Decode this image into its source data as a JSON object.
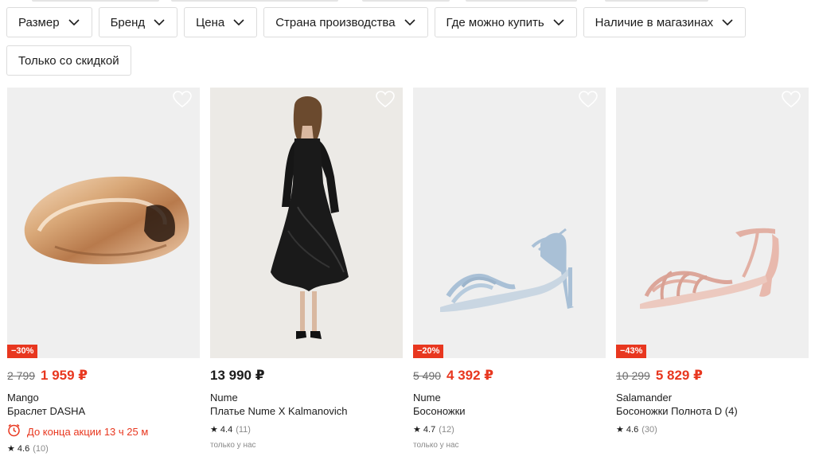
{
  "filters": [
    {
      "label": "Размер",
      "has_dropdown": true
    },
    {
      "label": "Бренд",
      "has_dropdown": true
    },
    {
      "label": "Цена",
      "has_dropdown": true
    },
    {
      "label": "Страна производства",
      "has_dropdown": true
    },
    {
      "label": "Где можно купить",
      "has_dropdown": true
    },
    {
      "label": "Наличие в магазинах",
      "has_dropdown": true
    },
    {
      "label": "Только со скидкой",
      "has_dropdown": false
    }
  ],
  "products": [
    {
      "discount_badge": "−30%",
      "old_price": "2 799",
      "price": "1 959 ₽",
      "brand": "Mango",
      "name": "Браслет DASHA",
      "promo": "До конца акции 13 ч 25 м",
      "rating": "★ 4.6",
      "reviews": "(10)",
      "exclusive": ""
    },
    {
      "discount_badge": "",
      "old_price": "",
      "price": "13 990 ₽",
      "brand": "Nume",
      "name": "Платье Nume X Kalmanovich",
      "promo": "",
      "rating": "★ 4.4",
      "reviews": "(11)",
      "exclusive": "только у нас"
    },
    {
      "discount_badge": "−20%",
      "old_price": "5 490",
      "price": "4 392 ₽",
      "brand": "Nume",
      "name": "Босоножки",
      "promo": "",
      "rating": "★ 4.7",
      "reviews": "(12)",
      "exclusive": "только у нас"
    },
    {
      "discount_badge": "−43%",
      "old_price": "10 299",
      "price": "5 829 ₽",
      "brand": "Salamander",
      "name": "Босоножки Полнота D (4)",
      "promo": "",
      "rating": "★ 4.6",
      "reviews": "(30)",
      "exclusive": ""
    }
  ],
  "icons": {
    "chevron": "chevron-down-icon",
    "favorite": "heart-outline-icon",
    "timer": "clock-icon"
  },
  "colors": {
    "accent": "#e8371f",
    "chip_border": "#dcdcdc",
    "photo_bg": "#efefef"
  }
}
